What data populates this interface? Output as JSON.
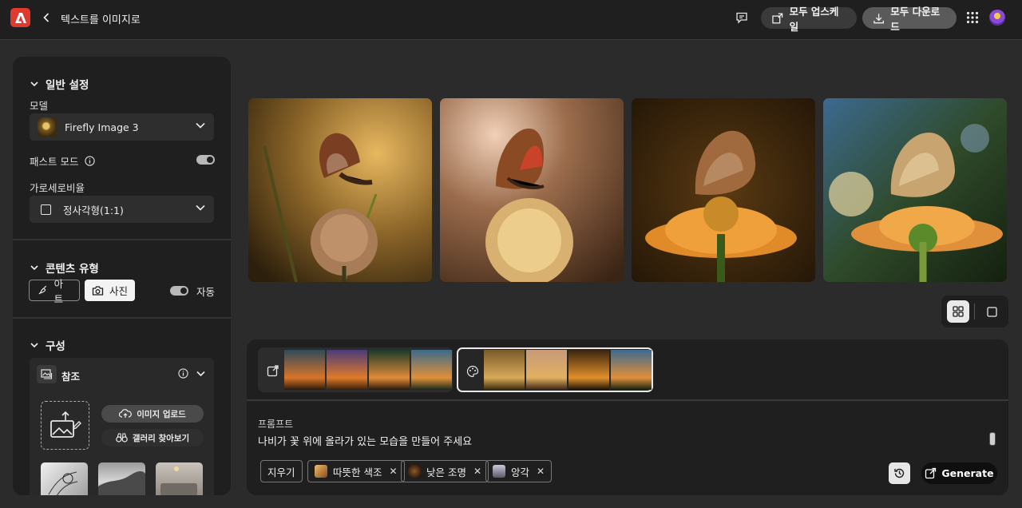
{
  "header": {
    "title": "텍스트를 이미지로",
    "upscale_label": "모두 업스케일",
    "download_label": "모두 다운로드"
  },
  "sidebar": {
    "general": {
      "heading": "일반 설정",
      "model_label": "모델",
      "model_value": "Firefly Image 3",
      "fast_mode_label": "패스트 모드",
      "fast_mode_on": true,
      "aspect_label": "가로세로비율",
      "aspect_value": "정사각형(1:1)"
    },
    "content_type": {
      "heading": "콘텐츠 유형",
      "art_label": "아트",
      "photo_label": "사진",
      "auto_label": "자동",
      "selected": "사진"
    },
    "composition": {
      "heading": "구성",
      "reference_label": "참조",
      "upload_label": "이미지 업로드",
      "gallery_label": "갤러리 찾아보기"
    }
  },
  "prompt": {
    "label": "프롬프트",
    "text": "나비가 꽃 위에 올라가 있는 모습을 만들어 주세요",
    "clear_label": "지우기",
    "chips": [
      "따뜻한 색조",
      "낮은 조명",
      "앙각"
    ],
    "generate_label": "Generate"
  },
  "colors": {
    "background": "#2b2b2b",
    "panel": "#1f1f1f",
    "brand_red": "#e03a2f"
  }
}
